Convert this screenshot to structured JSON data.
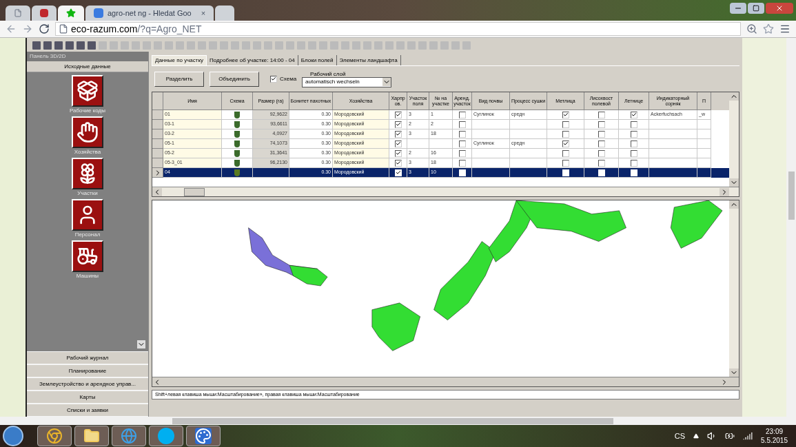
{
  "browser": {
    "tabs": [
      {
        "kind": "file",
        "selected": false
      },
      {
        "kind": "logo",
        "selected": false
      },
      {
        "kind": "star",
        "selected": true
      },
      {
        "kind": "search",
        "title": "agro-net ng - Hledat Goo",
        "close": "×",
        "selected": false
      },
      {
        "kind": "new",
        "selected": false
      }
    ],
    "url": {
      "host": "eco-razum.com",
      "path": "/?q=Agro_NET"
    }
  },
  "sidebar": {
    "title": "Панель 3D/2D",
    "section": "Исходные данные",
    "items": [
      {
        "kind": "box",
        "label": "Рабочие коды"
      },
      {
        "kind": "hand",
        "label": "Хозяйства"
      },
      {
        "kind": "flower",
        "label": "Участки"
      },
      {
        "kind": "person",
        "label": "Персонал"
      },
      {
        "kind": "tractor",
        "label": "Машины"
      }
    ],
    "sections": [
      "Рабочий журнал",
      "Планирование",
      "Землеустройство и арендное управ...",
      "Карты",
      "Списки и заявки"
    ]
  },
  "tabs": [
    {
      "label": "Данные по участку",
      "selected": true
    },
    {
      "label": "Подробнее об участке: 14:00 - 04",
      "selected": false
    },
    {
      "label": "Блоки полей",
      "selected": false
    },
    {
      "label": "Элементы ландшафта",
      "selected": false
    }
  ],
  "toolbar": {
    "buttons": [
      "Разделить",
      "Объединить"
    ],
    "scheme": {
      "label": "Схема",
      "checked": true
    },
    "layer": {
      "label": "Рабочий слой",
      "value": "automatisch wechseln"
    }
  },
  "table": {
    "columns": [
      {
        "label": "Имя",
        "kind": "name"
      },
      {
        "label": "Схема",
        "kind": "icon"
      },
      {
        "label": "Размер (га)",
        "kind": "size"
      },
      {
        "label": "Бонитет пахотных",
        "kind": "num"
      },
      {
        "label": "Хозяйства",
        "kind": "farm"
      },
      {
        "label": "Харпр ов.",
        "kind": "check"
      },
      {
        "label": "Участок поля",
        "kind": "text"
      },
      {
        "label": "№ на участке",
        "kind": "text"
      },
      {
        "label": "Аренд. участок",
        "kind": "check"
      },
      {
        "label": "Вид почвы",
        "kind": "text"
      },
      {
        "label": "Процесс сушки",
        "kind": "text"
      },
      {
        "label": "Метлица",
        "kind": "check"
      },
      {
        "label": "Лисохвост полевой",
        "kind": "check"
      },
      {
        "label": "Летнице",
        "kind": "check"
      },
      {
        "label": "Индикаторный сорняк",
        "kind": "text"
      },
      {
        "label": "П",
        "kind": "text"
      }
    ],
    "rows": [
      {
        "selected": false,
        "cells": [
          "01",
          null,
          "92,9622",
          "0.30",
          "Мородовский",
          true,
          "3",
          "1",
          false,
          "Суглинок",
          "средн",
          true,
          false,
          true,
          "Ackerfuchsach",
          "_w"
        ]
      },
      {
        "selected": false,
        "cells": [
          "03-1",
          null,
          "93,6611",
          "0.30",
          "Мородовский",
          true,
          "2",
          "2",
          false,
          null,
          null,
          false,
          false,
          false,
          null,
          null
        ]
      },
      {
        "selected": false,
        "cells": [
          "03-2",
          null,
          "4,0927",
          "0.30",
          "Мородовский",
          true,
          "3",
          "18",
          false,
          null,
          null,
          false,
          false,
          false,
          null,
          null
        ]
      },
      {
        "selected": false,
        "cells": [
          "05-1",
          null,
          "74,1073",
          "0.30",
          "Мородовский",
          true,
          null,
          null,
          false,
          "Суглинок",
          "средн",
          true,
          false,
          false,
          null,
          null
        ]
      },
      {
        "selected": false,
        "cells": [
          "05-2",
          null,
          "31,3641",
          "0.30",
          "Мородовский",
          true,
          "2",
          "16",
          false,
          null,
          null,
          false,
          false,
          false,
          null,
          null
        ]
      },
      {
        "selected": false,
        "cells": [
          "05-3_01",
          null,
          "96,2130",
          "0.30",
          "Мородовский",
          true,
          "3",
          "18",
          false,
          null,
          null,
          false,
          false,
          false,
          null,
          null
        ]
      },
      {
        "selected": true,
        "cells": [
          "04",
          null,
          null,
          "0.30",
          "Мородовский",
          true,
          "3",
          "10",
          false,
          null,
          null,
          false,
          false,
          false,
          null,
          null
        ]
      }
    ]
  },
  "status": "Shift+левая клавиша мыши:Масштабирование», правая клавиша мыши:Масштабирование",
  "taskbar": {
    "apps": [
      {
        "kind": "chrome"
      },
      {
        "kind": "folder"
      },
      {
        "kind": "ie"
      },
      {
        "kind": "skype"
      },
      {
        "kind": "paint"
      }
    ],
    "language": "CS",
    "time": "23:09",
    "date": "5.5.2015"
  }
}
